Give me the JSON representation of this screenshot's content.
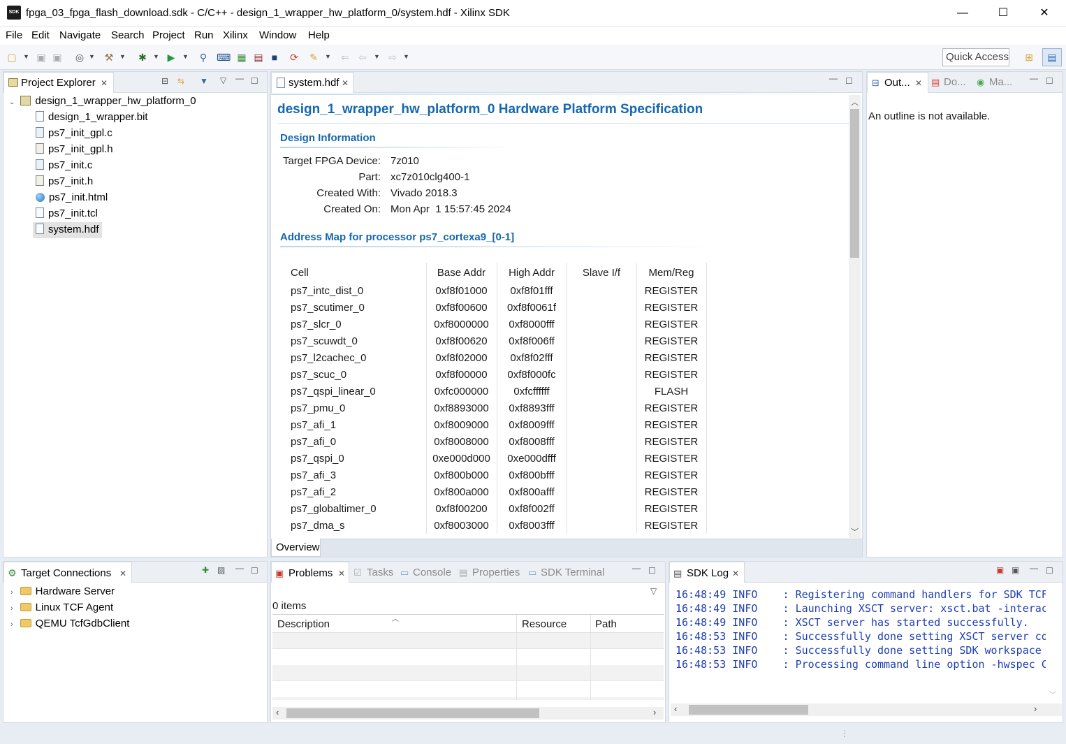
{
  "window": {
    "title": "fpga_03_fpga_flash_download.sdk - C/C++ - design_1_wrapper_hw_platform_0/system.hdf - Xilinx SDK",
    "app_icon_text": "SDK",
    "minimize": "—",
    "maximize": "☐",
    "close": "✕"
  },
  "menu": [
    "File",
    "Edit",
    "Navigate",
    "Search",
    "Project",
    "Run",
    "Xilinx",
    "Window",
    "Help"
  ],
  "toolbar": {
    "quick_access_placeholder": "Quick Access"
  },
  "project_explorer": {
    "tab_label": "Project Explorer",
    "root": "design_1_wrapper_hw_platform_0",
    "files": [
      {
        "name": "design_1_wrapper.bit",
        "icon": "file-icon"
      },
      {
        "name": "ps7_init_gpl.c",
        "icon": "c-file-icon"
      },
      {
        "name": "ps7_init_gpl.h",
        "icon": "h-file-icon"
      },
      {
        "name": "ps7_init.c",
        "icon": "c-file-icon"
      },
      {
        "name": "ps7_init.h",
        "icon": "h-file-icon"
      },
      {
        "name": "ps7_init.html",
        "icon": "html-globe-icon"
      },
      {
        "name": "ps7_init.tcl",
        "icon": "file-icon"
      },
      {
        "name": "system.hdf",
        "icon": "hdf-file-icon",
        "selected": true
      }
    ]
  },
  "editor": {
    "tab_label": "system.hdf",
    "heading": "design_1_wrapper_hw_platform_0 Hardware Platform Specification",
    "design_info": {
      "title": "Design Information",
      "rows": [
        {
          "label": "Target FPGA Device:",
          "value": "7z010"
        },
        {
          "label": "Part:",
          "value": "xc7z010clg400-1"
        },
        {
          "label": "Created With:",
          "value": "Vivado 2018.3"
        },
        {
          "label": "Created On:",
          "value": "Mon Apr  1 15:57:45 2024"
        }
      ]
    },
    "address_map": {
      "title": "Address Map for processor ps7_cortexa9_[0-1]",
      "columns": [
        "Cell",
        "Base Addr",
        "High Addr",
        "Slave I/f",
        "Mem/Reg"
      ],
      "rows": [
        [
          "ps7_intc_dist_0",
          "0xf8f01000",
          "0xf8f01fff",
          "",
          "REGISTER"
        ],
        [
          "ps7_scutimer_0",
          "0xf8f00600",
          "0xf8f0061f",
          "",
          "REGISTER"
        ],
        [
          "ps7_slcr_0",
          "0xf8000000",
          "0xf8000fff",
          "",
          "REGISTER"
        ],
        [
          "ps7_scuwdt_0",
          "0xf8f00620",
          "0xf8f006ff",
          "",
          "REGISTER"
        ],
        [
          "ps7_l2cachec_0",
          "0xf8f02000",
          "0xf8f02fff",
          "",
          "REGISTER"
        ],
        [
          "ps7_scuc_0",
          "0xf8f00000",
          "0xf8f000fc",
          "",
          "REGISTER"
        ],
        [
          "ps7_qspi_linear_0",
          "0xfc000000",
          "0xfcffffff",
          "",
          "FLASH"
        ],
        [
          "ps7_pmu_0",
          "0xf8893000",
          "0xf8893fff",
          "",
          "REGISTER"
        ],
        [
          "ps7_afi_1",
          "0xf8009000",
          "0xf8009fff",
          "",
          "REGISTER"
        ],
        [
          "ps7_afi_0",
          "0xf8008000",
          "0xf8008fff",
          "",
          "REGISTER"
        ],
        [
          "ps7_qspi_0",
          "0xe000d000",
          "0xe000dfff",
          "",
          "REGISTER"
        ],
        [
          "ps7_afi_3",
          "0xf800b000",
          "0xf800bfff",
          "",
          "REGISTER"
        ],
        [
          "ps7_afi_2",
          "0xf800a000",
          "0xf800afff",
          "",
          "REGISTER"
        ],
        [
          "ps7_globaltimer_0",
          "0xf8f00200",
          "0xf8f002ff",
          "",
          "REGISTER"
        ],
        [
          "ps7_dma_s",
          "0xf8003000",
          "0xf8003fff",
          "",
          "REGISTER"
        ]
      ]
    },
    "bottom_tab": "Overview"
  },
  "outline": {
    "tabs": [
      "Out...",
      "Do...",
      "Ma..."
    ],
    "message": "An outline is not available."
  },
  "target_connections": {
    "tab_label": "Target Connections",
    "items": [
      "Hardware Server",
      "Linux TCF Agent",
      "QEMU TcfGdbClient"
    ]
  },
  "problems": {
    "tabs": [
      "Problems",
      "Tasks",
      "Console",
      "Properties",
      "SDK Terminal"
    ],
    "count": "0 items",
    "columns": [
      "Description",
      "Resource",
      "Path"
    ]
  },
  "sdk_log": {
    "tab_label": "SDK Log",
    "lines": [
      {
        "time": "16:48:49",
        "level": "INFO",
        "msg": ": Registering command handlers for SDK TCF"
      },
      {
        "time": "16:48:49",
        "level": "INFO",
        "msg": ": Launching XSCT server: xsct.bat -interact"
      },
      {
        "time": "16:48:49",
        "level": "INFO",
        "msg": ": XSCT server has started successfully."
      },
      {
        "time": "16:48:53",
        "level": "INFO",
        "msg": ": Successfully done setting XSCT server con"
      },
      {
        "time": "16:48:53",
        "level": "INFO",
        "msg": ": Successfully done setting SDK workspace"
      },
      {
        "time": "16:48:53",
        "level": "INFO",
        "msg": ": Processing command line option -hwspec C:"
      }
    ]
  }
}
